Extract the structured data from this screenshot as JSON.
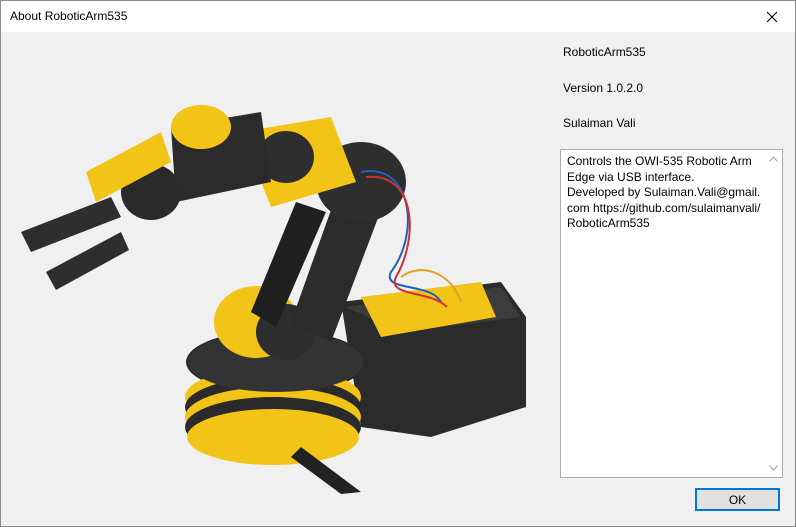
{
  "window": {
    "title": "About RoboticArm535"
  },
  "about": {
    "product_name": "RoboticArm535",
    "version": "Version 1.0.2.0",
    "author": "Sulaiman Vali",
    "description": "Controls the OWI-535 Robotic Arm Edge via USB interface.\nDeveloped by Sulaiman.Vali@gmail.com https://github.com/sulaimanvali/RoboticArm535"
  },
  "buttons": {
    "ok": "OK"
  },
  "icons": {
    "close": "close-icon",
    "scroll_up": "chevron-up-icon",
    "scroll_down": "chevron-down-icon"
  },
  "colors": {
    "accent": "#0078d7",
    "arm_yellow": "#f5c518",
    "arm_black": "#2a2a2a"
  }
}
